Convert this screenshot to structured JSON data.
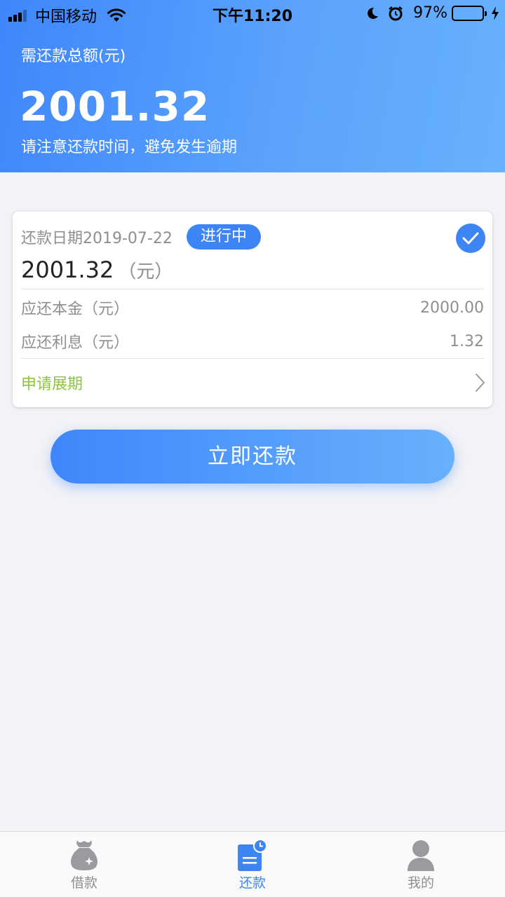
{
  "status_bar": {
    "carrier": "中国移动",
    "time": "下午11:20",
    "battery_percent": "97%",
    "battery_level": 0.97,
    "signal_bars": 3
  },
  "header": {
    "label": "需还款总额(元)",
    "amount": "2001.32",
    "tip": "请注意还款时间，避免发生逾期"
  },
  "bill": {
    "date": "还款日期2019-07-22",
    "status": "进行中",
    "amount": "2001.32",
    "unit": "（元）",
    "principal_label": "应还本金（元）",
    "principal_value": "2000.00",
    "interest_label": "应还利息（元）",
    "interest_value": "1.32",
    "extend_label": "申请展期",
    "selected": true
  },
  "pay_button": {
    "label": "立即还款"
  },
  "tabs": [
    {
      "label": "借款",
      "icon": "money-bag-icon",
      "active": false
    },
    {
      "label": "还款",
      "icon": "bill-clock-icon",
      "active": true
    },
    {
      "label": "我的",
      "icon": "user-icon",
      "active": false
    }
  ],
  "colors": {
    "accent": "#3d85f5",
    "header_gradient_start": "#3f86fb",
    "header_gradient_end": "#67b1fd",
    "extend_text": "#8cc63f",
    "background": "#f2f2f7",
    "inactive_tab": "#8e8e93"
  }
}
